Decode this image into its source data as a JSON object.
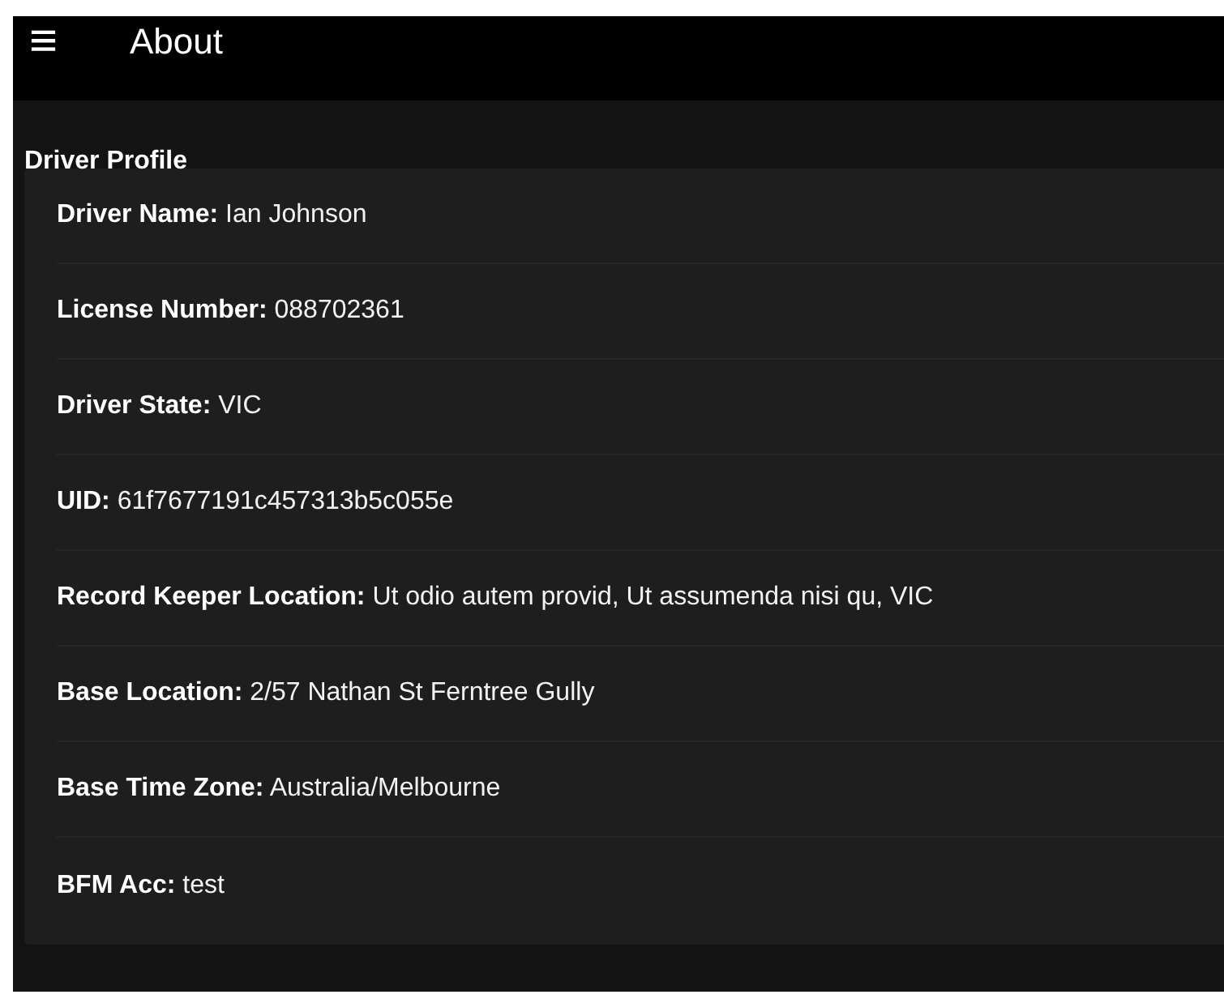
{
  "header": {
    "menu": "≡",
    "title": "About"
  },
  "section": {
    "title": "Driver Profile"
  },
  "fields": [
    {
      "text": "**Driver Name:** Ian Johnson"
    },
    {
      "text": "**License Number:** 088702361"
    },
    {
      "text": "**Driver State:** VIC"
    },
    {
      "text": "**UID:** 61f7677191c457313b5c055e"
    },
    {
      "text": "**Record Keeper Location:** Ut odio autem provid, Ut assumenda nisi qu, VIC"
    },
    {
      "text": "**Base Location:** 2/57 Nathan St Ferntree Gully"
    },
    {
      "text": "**Base Time Zone:** Australia/Melbourne"
    },
    {
      "text": "**BFM Acc:** test"
    }
  ]
}
